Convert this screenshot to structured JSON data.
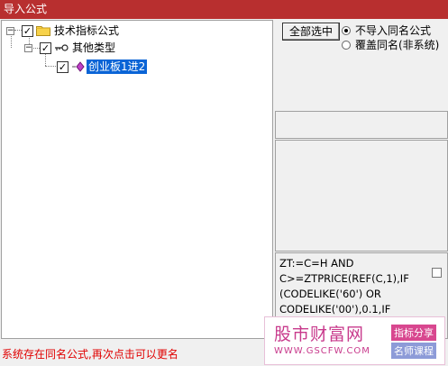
{
  "window": {
    "title": "导入公式"
  },
  "tree": {
    "root": {
      "label": "技术指标公式",
      "checked": true,
      "expander": "−"
    },
    "child": {
      "label": "其他类型",
      "checked": true,
      "expander": "−"
    },
    "leaf": {
      "label": "创业板1进2",
      "checked": true
    }
  },
  "actions": {
    "select_all_label": "全部选中"
  },
  "options": {
    "no_import": "不导入同名公式",
    "overwrite": "覆盖同名(非系统)",
    "selected": "no_import"
  },
  "formula": {
    "lines": [
      "ZT:=C=H AND",
      "C>=ZTPRICE(REF(C,1),IF",
      "(CODELIKE('60') OR",
      "CODELIKE('00'),0.1,IF"
    ]
  },
  "status": {
    "message": "系统存在同名公式,再次点击可以更名",
    "color": "#e00000"
  },
  "watermark": {
    "title": "股市财富网",
    "url": "WWW.GSCFW.COM",
    "tag1": "指标分享",
    "tag2": "名师课程"
  },
  "colors": {
    "titlebar": "#b82f2f",
    "selection": "#0a64d6"
  }
}
